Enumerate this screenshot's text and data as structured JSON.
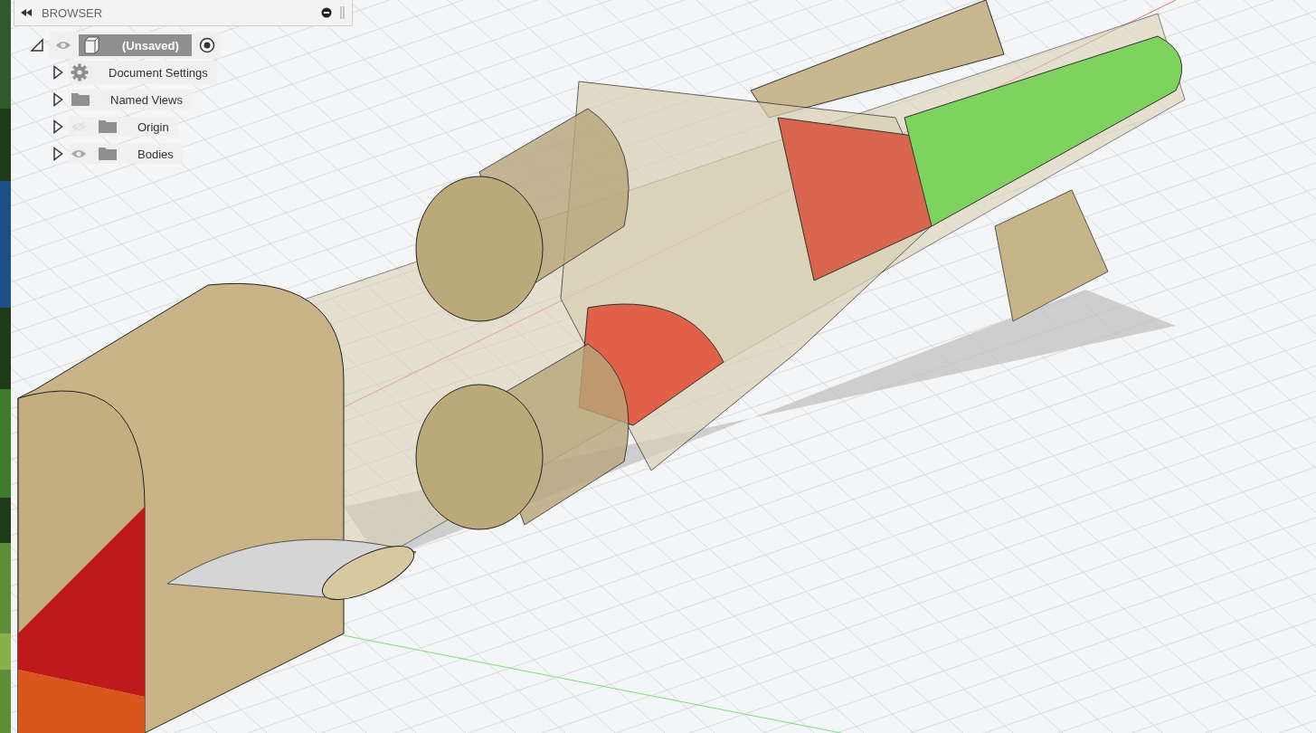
{
  "browser": {
    "title": "BROWSER",
    "root": {
      "label": "(Unsaved)",
      "expanded": true,
      "visible": true,
      "active": true,
      "children": [
        {
          "label": "Document Settings",
          "kind": "settings",
          "expanded": false
        },
        {
          "label": "Named Views",
          "kind": "folder",
          "expanded": false
        },
        {
          "label": "Origin",
          "kind": "folder",
          "expanded": false,
          "visible": false
        },
        {
          "label": "Bodies",
          "kind": "folder",
          "expanded": false,
          "visible": true
        }
      ]
    }
  },
  "viewport": {
    "model": {
      "kind": "rocket"
    }
  }
}
